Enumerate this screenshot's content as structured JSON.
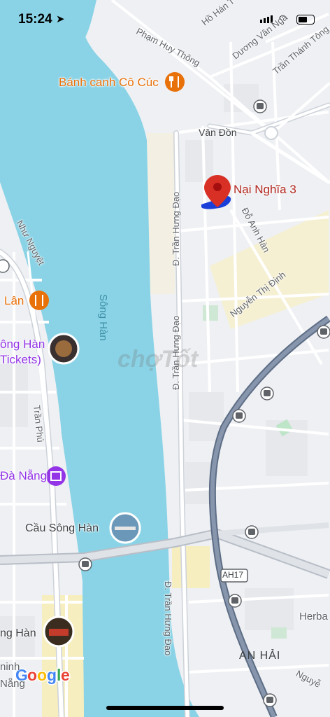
{
  "status_bar": {
    "time": "15:24"
  },
  "map": {
    "streets": {
      "ho_han": "Hồ Hán T",
      "duong_van_nga": "Dương Vân Nga",
      "pham_huy_thong": "Phạm Huy Thông",
      "tran_thanh_tong": "Trần Thánh Tông",
      "van_don": "Vân Đồn",
      "tran_hung_dao_1": "Đ. Trần Hưng Đạo",
      "tran_hung_dao_2": "Đ. Trần Hưng Đạo",
      "tran_hung_dao_3": "Đ. Trần Hưng Đạo",
      "nhu_nguyet": "Như Nguyệt",
      "do_anh_han": "Đỗ Anh Hàn",
      "nguyen_thi_dinh": "Nguyễn Thị Định",
      "tran_phu": "Trần Phú",
      "nguyen_right": "Nguyễ",
      "highway": "AH17"
    },
    "places": {
      "banh_canh": "Bánh canh Cô Cúc",
      "lan": "Lân",
      "song_han_tickets_1": "ông Hàn",
      "song_han_tickets_2": "Tickets)",
      "da_nang": "Đà Nẵng",
      "cau_song_han": "Cầu Sông Hàn",
      "song_han_bottom": "ng Hàn",
      "an_hai": "AN HẢI",
      "herba": "Herba",
      "minh": "ninh",
      "nang": "Nẵng"
    },
    "water": {
      "river": "Sông Hàn"
    },
    "pin": {
      "label": "Nại Nghĩa 3",
      "color": "#d93025"
    },
    "watermark": "chợTốt",
    "logo": "Google",
    "colors": {
      "water": "#8ad3e6",
      "road": "#ffffff",
      "highway": "#6c7c93",
      "land": "#eef0f3",
      "block": "#f5f5f0",
      "sand": "#f7eebf"
    }
  }
}
